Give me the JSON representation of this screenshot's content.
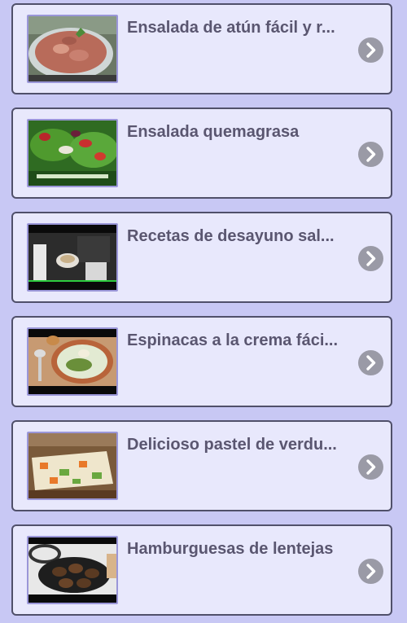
{
  "recipes": [
    {
      "title": "Ensalada de atún fácil y r...",
      "thumbnail": "tuna-salad-photo"
    },
    {
      "title": "Ensalada quemagrasa",
      "thumbnail": "fat-burning-salad-photo"
    },
    {
      "title": "Recetas de desayuno sal...",
      "thumbnail": "breakfast-video-photo"
    },
    {
      "title": "Espinacas a la crema fáci...",
      "thumbnail": "creamed-spinach-photo"
    },
    {
      "title": "Delicioso pastel de verdu...",
      "thumbnail": "vegetable-terrine-photo"
    },
    {
      "title": "Hamburguesas de lentejas",
      "thumbnail": "lentil-burgers-photo"
    }
  ],
  "colors": {
    "background": "#c8c8f4",
    "card": "#e8e8fc",
    "card_border": "#50506a",
    "title_text": "#5a5670",
    "chevron": "#9a9aa6"
  }
}
